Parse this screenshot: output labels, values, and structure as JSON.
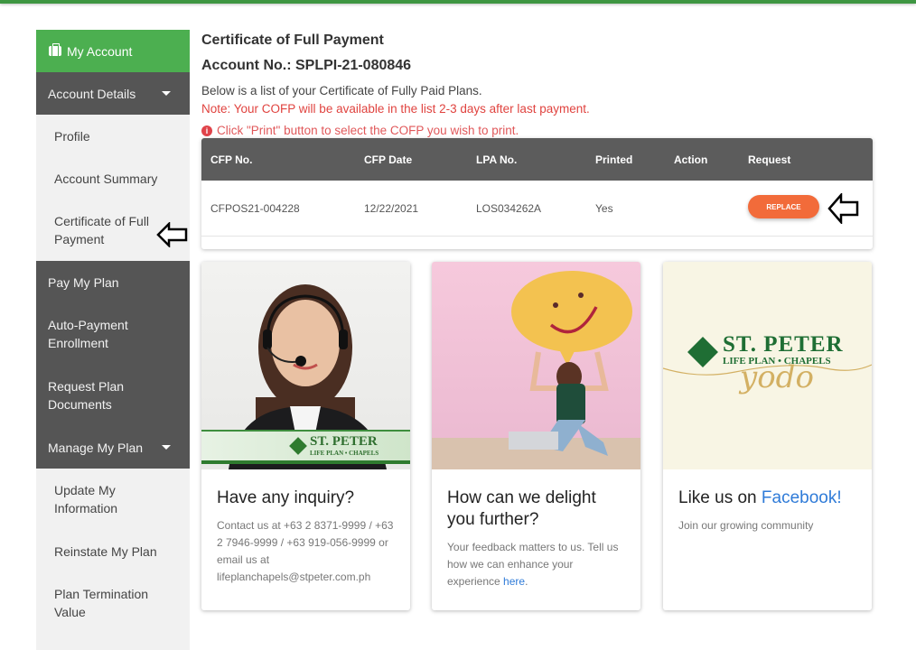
{
  "sidebar": {
    "header": "My Account",
    "items": [
      {
        "label": "Account Details",
        "style": "dark",
        "expandable": true
      },
      {
        "label": "Profile",
        "style": "light"
      },
      {
        "label": "Account Summary",
        "style": "light"
      },
      {
        "label": "Certificate of Full Payment",
        "style": "light",
        "active": true
      },
      {
        "label": "Pay My Plan",
        "style": "dark"
      },
      {
        "label": "Auto-Payment Enrollment",
        "style": "dark"
      },
      {
        "label": "Request Plan Documents",
        "style": "dark"
      },
      {
        "label": "Manage My Plan",
        "style": "dark",
        "expandable": true
      },
      {
        "label": "Update My Information",
        "style": "light"
      },
      {
        "label": "Reinstate My Plan",
        "style": "light"
      },
      {
        "label": "Plan Termination Value",
        "style": "light"
      }
    ]
  },
  "main": {
    "title": "Certificate of Full Payment",
    "account_label": "Account No.: SPLPI-21-080846",
    "description": "Below is a list of your Certificate of Fully Paid Plans.",
    "note": "Note: Your COFP will be available in the list 2-3 days after last payment.",
    "hint": "Click \"Print\" button to select the COFP you wish to print.",
    "table": {
      "headers": [
        "CFP No.",
        "CFP Date",
        "LPA No.",
        "Printed",
        "Action",
        "Request"
      ],
      "rows": [
        {
          "cfp_no": "CFPOS21-004228",
          "cfp_date": "12/22/2021",
          "lpa_no": "LOS034262A",
          "printed": "Yes",
          "action": "",
          "request_button": "REPLACE"
        }
      ]
    }
  },
  "cards": [
    {
      "title": "Have any inquiry?",
      "text": "Contact us at +63 2 8371-9999 / +63 2 7946-9999 / +63 919-056-9999 or email us at lifeplanchapels@stpeter.com.ph",
      "image": "customer-service-agent-photo",
      "banner_brand": "ST. PETER",
      "banner_sub": "LIFE PLAN • CHAPELS"
    },
    {
      "title": "How can we delight you further?",
      "text_before": "Your feedback matters to us. Tell us how we can enhance your experience ",
      "link": "here",
      "text_after": ".",
      "image": "smiley-speech-bubble-photo"
    },
    {
      "title_before": "Like us on ",
      "title_link": "Facebook!",
      "text": "Join our growing community",
      "image": "st-peter-yodo-logo",
      "logo_brand": "ST. PETER",
      "logo_sub": "LIFE PLAN • CHAPELS",
      "logo_script": "yodo"
    }
  ],
  "colors": {
    "brand_green": "#4caf50",
    "top_bar": "#3e9642",
    "sidebar_dark": "#555555",
    "accent_orange": "#f26b3a",
    "note_red": "#e0433f",
    "link_blue": "#2f7bd8"
  }
}
